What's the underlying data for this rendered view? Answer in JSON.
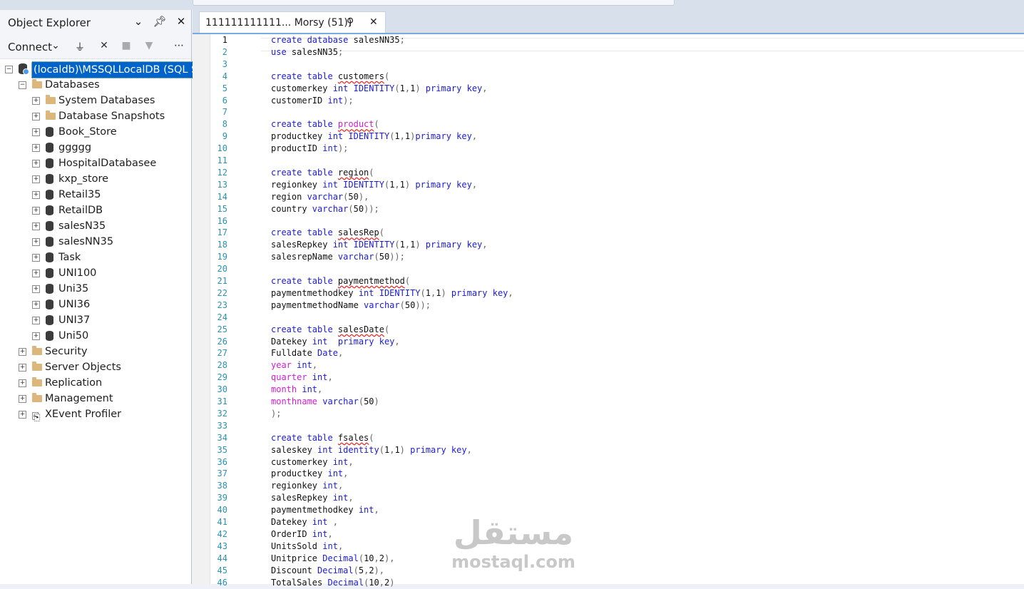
{
  "object_explorer": {
    "title": "Object Explorer",
    "connect_label": "Connect",
    "icons": {
      "dropdown": "chevron-down-icon",
      "pin": "pin-icon",
      "close": "close-icon",
      "connect": "plug-icon",
      "disconnect": "disconnect-icon",
      "stop": "stop-icon",
      "filter": "filter-icon",
      "more": "more-icon"
    },
    "server": "(localdb)\\MSSQLLocalDB (SQL Ser",
    "databases_label": "Databases",
    "database_items": [
      {
        "label": "System Databases",
        "type": "folder"
      },
      {
        "label": "Database Snapshots",
        "type": "folder"
      },
      {
        "label": "Book_Store",
        "type": "db"
      },
      {
        "label": "ggggg",
        "type": "db"
      },
      {
        "label": "HospitalDatabasee",
        "type": "db"
      },
      {
        "label": "kxp_store",
        "type": "db"
      },
      {
        "label": "Retail35",
        "type": "db"
      },
      {
        "label": "RetailDB",
        "type": "db"
      },
      {
        "label": "salesN35",
        "type": "db"
      },
      {
        "label": "salesNN35",
        "type": "db"
      },
      {
        "label": "Task",
        "type": "db"
      },
      {
        "label": "UNI100",
        "type": "db"
      },
      {
        "label": "Uni35",
        "type": "db"
      },
      {
        "label": "UNI36",
        "type": "db"
      },
      {
        "label": "UNI37",
        "type": "db"
      },
      {
        "label": "Uni50",
        "type": "db"
      }
    ],
    "server_items": [
      {
        "label": "Security",
        "type": "folder"
      },
      {
        "label": "Server Objects",
        "type": "folder"
      },
      {
        "label": "Replication",
        "type": "folder"
      },
      {
        "label": "Management",
        "type": "folder"
      },
      {
        "label": "XEvent Profiler",
        "type": "xevent"
      }
    ]
  },
  "editor": {
    "tab_title": "111111111111... Morsy (51))",
    "current_line": 1,
    "lines": [
      [
        [
          "k",
          "create database "
        ],
        [
          "n",
          "salesNN35"
        ],
        [
          "p",
          ";"
        ]
      ],
      [
        [
          "k",
          "use "
        ],
        [
          "n",
          "salesNN35"
        ],
        [
          "p",
          ";"
        ]
      ],
      [],
      [
        [
          "k",
          "create table "
        ],
        [
          "s",
          "customers"
        ],
        [
          "p",
          "("
        ]
      ],
      [
        [
          "n",
          "customerkey "
        ],
        [
          "k",
          "int IDENTITY"
        ],
        [
          "p",
          "("
        ],
        [
          "n",
          "1"
        ],
        [
          "p",
          ","
        ],
        [
          "n",
          "1"
        ],
        [
          "p",
          ") "
        ],
        [
          "k",
          "primary key"
        ],
        [
          "p",
          ","
        ]
      ],
      [
        [
          "n",
          "customerID "
        ],
        [
          "k",
          "int"
        ],
        [
          "p",
          ");"
        ]
      ],
      [],
      [
        [
          "k",
          "create table "
        ],
        [
          "fs",
          "product"
        ],
        [
          "p",
          "("
        ]
      ],
      [
        [
          "n",
          "productkey "
        ],
        [
          "k",
          "int IDENTITY"
        ],
        [
          "p",
          "("
        ],
        [
          "n",
          "1"
        ],
        [
          "p",
          ","
        ],
        [
          "n",
          "1"
        ],
        [
          "p",
          ")"
        ],
        [
          "k",
          "primary key"
        ],
        [
          "p",
          ","
        ]
      ],
      [
        [
          "n",
          "productID "
        ],
        [
          "k",
          "int"
        ],
        [
          "p",
          ");"
        ]
      ],
      [],
      [
        [
          "k",
          "create table "
        ],
        [
          "s",
          "region"
        ],
        [
          "p",
          "("
        ]
      ],
      [
        [
          "n",
          "regionkey "
        ],
        [
          "k",
          "int IDENTITY"
        ],
        [
          "p",
          "("
        ],
        [
          "n",
          "1"
        ],
        [
          "p",
          ","
        ],
        [
          "n",
          "1"
        ],
        [
          "p",
          ") "
        ],
        [
          "k",
          "primary key"
        ],
        [
          "p",
          ","
        ]
      ],
      [
        [
          "n",
          "region "
        ],
        [
          "k",
          "varchar"
        ],
        [
          "p",
          "("
        ],
        [
          "n",
          "50"
        ],
        [
          "p",
          "),"
        ]
      ],
      [
        [
          "n",
          "country "
        ],
        [
          "k",
          "varchar"
        ],
        [
          "p",
          "("
        ],
        [
          "n",
          "50"
        ],
        [
          "p",
          "));"
        ]
      ],
      [],
      [
        [
          "k",
          "create table "
        ],
        [
          "s",
          "salesRep"
        ],
        [
          "p",
          "("
        ]
      ],
      [
        [
          "n",
          "salesRepkey "
        ],
        [
          "k",
          "int IDENTITY"
        ],
        [
          "p",
          "("
        ],
        [
          "n",
          "1"
        ],
        [
          "p",
          ","
        ],
        [
          "n",
          "1"
        ],
        [
          "p",
          ") "
        ],
        [
          "k",
          "primary key"
        ],
        [
          "p",
          ","
        ]
      ],
      [
        [
          "n",
          "salesrepName "
        ],
        [
          "k",
          "varchar"
        ],
        [
          "p",
          "("
        ],
        [
          "n",
          "50"
        ],
        [
          "p",
          "));"
        ]
      ],
      [],
      [
        [
          "k",
          "create table "
        ],
        [
          "s",
          "paymentmethod"
        ],
        [
          "p",
          "("
        ]
      ],
      [
        [
          "n",
          "paymentmethodkey "
        ],
        [
          "k",
          "int IDENTITY"
        ],
        [
          "p",
          "("
        ],
        [
          "n",
          "1"
        ],
        [
          "p",
          ","
        ],
        [
          "n",
          "1"
        ],
        [
          "p",
          ") "
        ],
        [
          "k",
          "primary key"
        ],
        [
          "p",
          ","
        ]
      ],
      [
        [
          "n",
          "paymentmethodName "
        ],
        [
          "k",
          "varchar"
        ],
        [
          "p",
          "("
        ],
        [
          "n",
          "50"
        ],
        [
          "p",
          "));"
        ]
      ],
      [],
      [
        [
          "k",
          "create table "
        ],
        [
          "s",
          "salesDate"
        ],
        [
          "p",
          "("
        ]
      ],
      [
        [
          "n",
          "Datekey "
        ],
        [
          "k",
          "int  primary key"
        ],
        [
          "p",
          ","
        ]
      ],
      [
        [
          "n",
          "Fulldate "
        ],
        [
          "k",
          "Date"
        ],
        [
          "p",
          ","
        ]
      ],
      [
        [
          "f",
          "year "
        ],
        [
          "k",
          "int"
        ],
        [
          "p",
          ","
        ]
      ],
      [
        [
          "f",
          "quarter "
        ],
        [
          "k",
          "int"
        ],
        [
          "p",
          ","
        ]
      ],
      [
        [
          "f",
          "month "
        ],
        [
          "k",
          "int"
        ],
        [
          "p",
          ","
        ]
      ],
      [
        [
          "f",
          "monthname "
        ],
        [
          "k",
          "varchar"
        ],
        [
          "p",
          "("
        ],
        [
          "n",
          "50"
        ],
        [
          "p",
          ")"
        ]
      ],
      [
        [
          "p",
          ");"
        ]
      ],
      [],
      [
        [
          "k",
          "create table "
        ],
        [
          "s",
          "fsales"
        ],
        [
          "p",
          "("
        ]
      ],
      [
        [
          "n",
          "saleskey "
        ],
        [
          "k",
          "int identity"
        ],
        [
          "p",
          "("
        ],
        [
          "n",
          "1"
        ],
        [
          "p",
          ","
        ],
        [
          "n",
          "1"
        ],
        [
          "p",
          ") "
        ],
        [
          "k",
          "primary key"
        ],
        [
          "p",
          ","
        ]
      ],
      [
        [
          "n",
          "customerkey "
        ],
        [
          "k",
          "int"
        ],
        [
          "p",
          ","
        ]
      ],
      [
        [
          "n",
          "productkey "
        ],
        [
          "k",
          "int"
        ],
        [
          "p",
          ","
        ]
      ],
      [
        [
          "n",
          "regionkey "
        ],
        [
          "k",
          "int"
        ],
        [
          "p",
          ","
        ]
      ],
      [
        [
          "n",
          "salesRepkey "
        ],
        [
          "k",
          "int"
        ],
        [
          "p",
          ","
        ]
      ],
      [
        [
          "n",
          "paymentmethodkey "
        ],
        [
          "k",
          "int"
        ],
        [
          "p",
          ","
        ]
      ],
      [
        [
          "n",
          "Datekey "
        ],
        [
          "k",
          "int"
        ],
        [
          "p",
          " ,"
        ]
      ],
      [
        [
          "n",
          "OrderID "
        ],
        [
          "k",
          "int"
        ],
        [
          "p",
          ","
        ]
      ],
      [
        [
          "n",
          "UnitsSold "
        ],
        [
          "k",
          "int"
        ],
        [
          "p",
          ","
        ]
      ],
      [
        [
          "n",
          "Unitprice "
        ],
        [
          "k",
          "Decimal"
        ],
        [
          "p",
          "("
        ],
        [
          "n",
          "10"
        ],
        [
          "p",
          ","
        ],
        [
          "n",
          "2"
        ],
        [
          "p",
          "),"
        ]
      ],
      [
        [
          "n",
          "Discount "
        ],
        [
          "k",
          "Decimal"
        ],
        [
          "p",
          "("
        ],
        [
          "n",
          "5"
        ],
        [
          "p",
          ","
        ],
        [
          "n",
          "2"
        ],
        [
          "p",
          "),"
        ]
      ],
      [
        [
          "n",
          "TotalSales "
        ],
        [
          "k",
          "Decimal"
        ],
        [
          "p",
          "("
        ],
        [
          "n",
          "10"
        ],
        [
          "p",
          ","
        ],
        [
          "n",
          "2"
        ],
        [
          "p",
          ")"
        ]
      ]
    ]
  },
  "watermark": {
    "arabic": "مستقل",
    "latin": "mostaql.com"
  }
}
